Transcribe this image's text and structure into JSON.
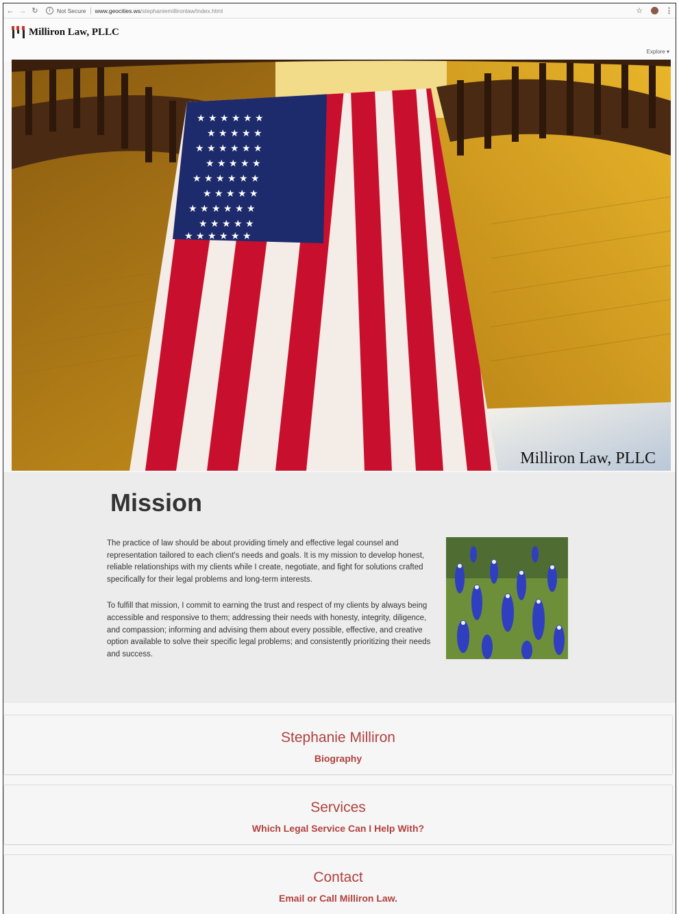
{
  "browser": {
    "security_label": "Not Secure",
    "url_host": "www.geocities.ws",
    "url_path": "/stephaniemillironlaw/index.html"
  },
  "header": {
    "brand": "Milliron Law, PLLC",
    "explore_label": "Explore ▾"
  },
  "hero": {
    "caption": "Milliron Law, PLLC"
  },
  "mission": {
    "title": "Mission",
    "paragraphs": [
      "The practice of law should be about providing timely and effective legal counsel and representation tailored to each client's needs and goals. It is my mission to develop honest, reliable relationships with my clients while I create, negotiate, and fight for solutions crafted specifically for their legal problems and long-term interests.",
      "To fulfill that mission, I commit to earning the trust and respect of my clients by always being accessible and responsive to them; addressing their needs with honesty, integrity, diligence, and compassion; informing and advising them about every possible, effective, and creative option available to solve their specific legal problems; and consistently prioritizing their needs and success."
    ]
  },
  "cards": [
    {
      "title": "Stephanie Milliron",
      "subtitle": "Biography"
    },
    {
      "title": "Services",
      "subtitle": "Which Legal Service Can I Help With?"
    },
    {
      "title": "Contact",
      "subtitle": "Email or Call Milliron Law."
    }
  ],
  "colors": {
    "accent": "#b0413e",
    "flag_red": "#c8102e",
    "flag_blue": "#1d2a6b"
  }
}
